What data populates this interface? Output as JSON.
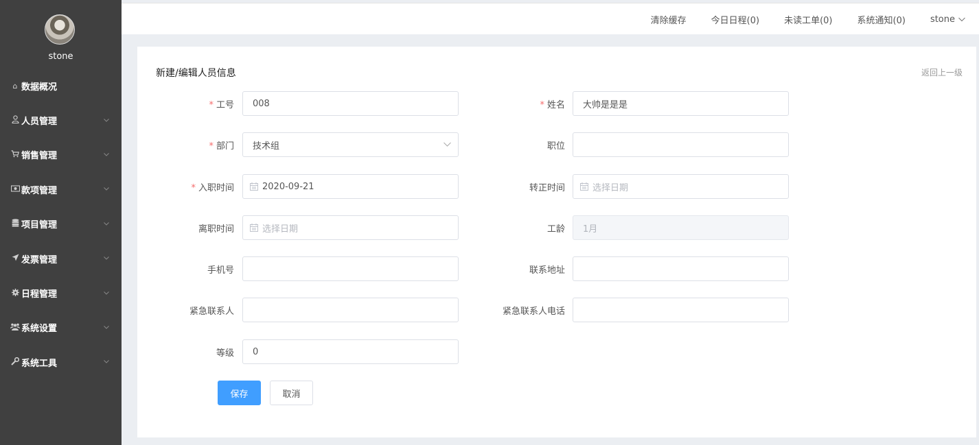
{
  "sidebar": {
    "username": "stone",
    "items": [
      {
        "label": "数据概况",
        "icon": "home-icon"
      },
      {
        "label": "人员管理",
        "icon": "user-icon"
      },
      {
        "label": "销售管理",
        "icon": "cart-icon"
      },
      {
        "label": "款项管理",
        "icon": "money-icon"
      },
      {
        "label": "项目管理",
        "icon": "database-icon"
      },
      {
        "label": "发票管理",
        "icon": "send-icon"
      },
      {
        "label": "日程管理",
        "icon": "gear-icon"
      },
      {
        "label": "系统设置",
        "icon": "users-icon"
      },
      {
        "label": "系统工具",
        "icon": "wrench-icon"
      }
    ]
  },
  "topbar": {
    "clear_cache": "清除缓存",
    "today_schedule": "今日日程(0)",
    "unread_orders": "未读工单(0)",
    "system_notice": "系统通知(0)",
    "user_menu": "stone"
  },
  "form": {
    "title": "新建/编辑人员信息",
    "back": "返回上一级",
    "fields": {
      "emp_no": {
        "label": "工号",
        "value": "008"
      },
      "name": {
        "label": "姓名",
        "value": "大帅是是是"
      },
      "dept": {
        "label": "部门",
        "value": "技术组"
      },
      "position": {
        "label": "职位",
        "value": ""
      },
      "hire_date": {
        "label": "入职时间",
        "value": "2020-09-21"
      },
      "regular_date": {
        "label": "转正时间",
        "placeholder": "选择日期"
      },
      "leave_date": {
        "label": "离职时间",
        "placeholder": "选择日期"
      },
      "seniority": {
        "label": "工龄",
        "value": "1月"
      },
      "phone": {
        "label": "手机号",
        "value": ""
      },
      "address": {
        "label": "联系地址",
        "value": ""
      },
      "emergency_contact": {
        "label": "紧急联系人",
        "value": ""
      },
      "emergency_phone": {
        "label": "紧急联系人电话",
        "value": ""
      },
      "level": {
        "label": "等级",
        "value": "0"
      }
    },
    "required_mark": "*",
    "save": "保存",
    "cancel": "取消"
  },
  "colors": {
    "sidebar_bg": "#404040",
    "primary": "#409eff",
    "required": "#f56c6c"
  }
}
